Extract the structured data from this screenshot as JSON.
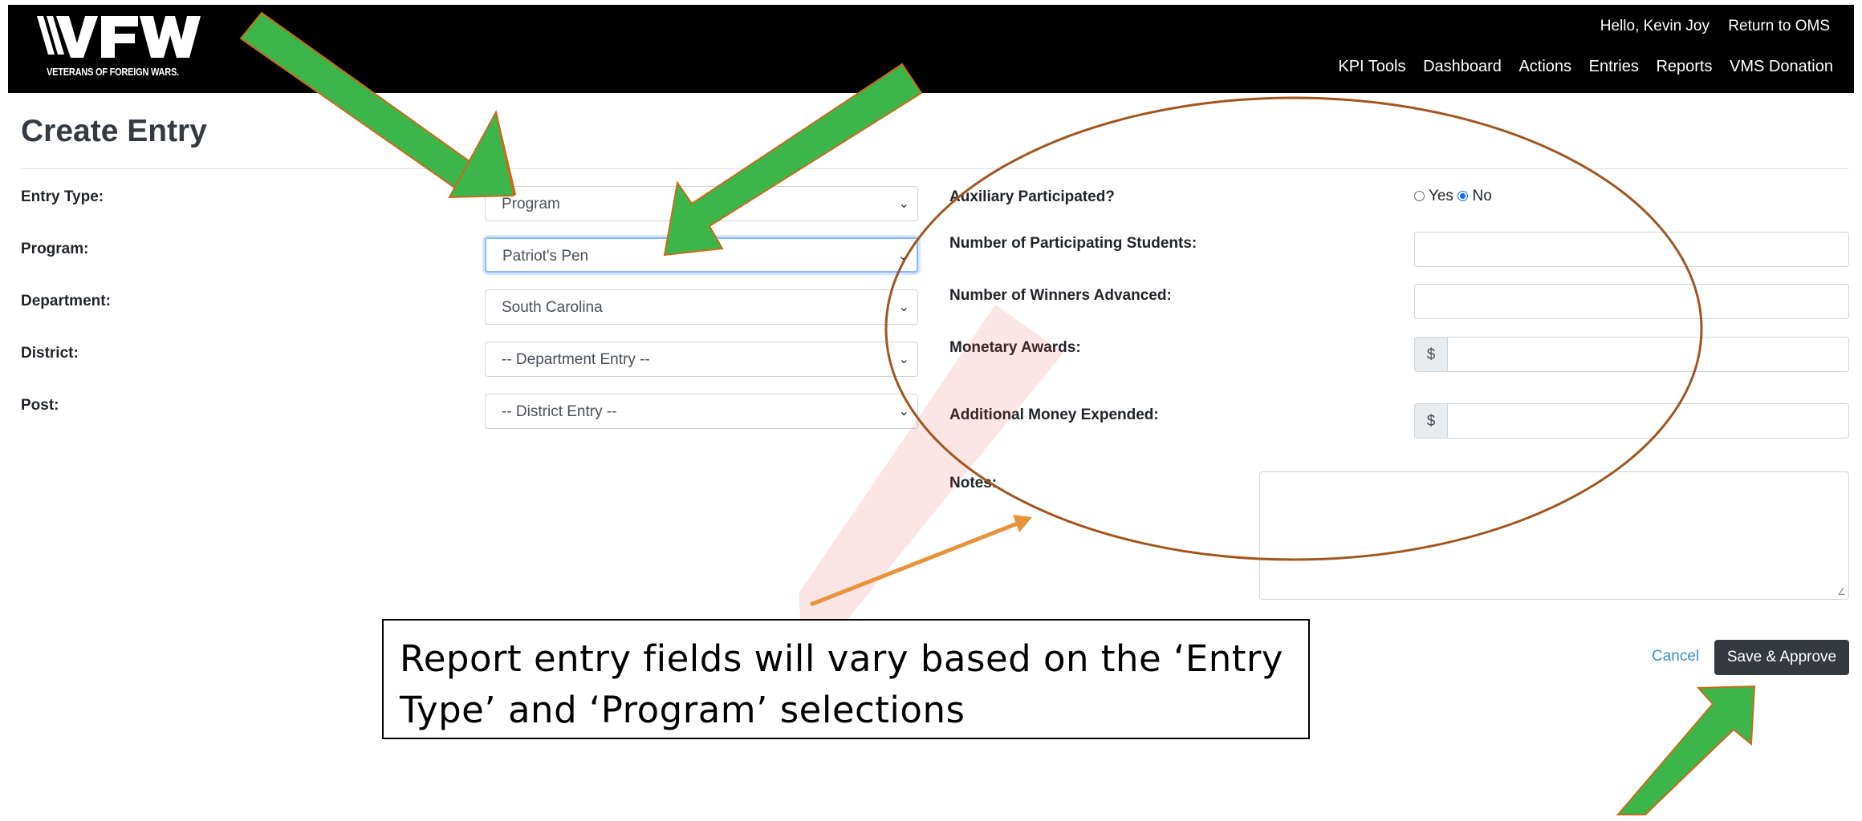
{
  "header": {
    "logo_text": "VETERANS OF FOREIGN WARS.",
    "greeting": "Hello, Kevin Joy",
    "return_link": "Return to OMS",
    "nav": [
      "KPI Tools",
      "Dashboard",
      "Actions",
      "Entries",
      "Reports",
      "VMS Donation"
    ]
  },
  "page": {
    "title": "Create Entry"
  },
  "form_left": {
    "entry_type": {
      "label": "Entry Type:",
      "value": "Program"
    },
    "program": {
      "label": "Program:",
      "value": "Patriot's Pen"
    },
    "department": {
      "label": "Department:",
      "value": "South Carolina"
    },
    "district": {
      "label": "District:",
      "value": "-- Department Entry --"
    },
    "post": {
      "label": "Post:",
      "value": "-- District Entry --"
    }
  },
  "form_right": {
    "auxiliary": {
      "label": "Auxiliary Participated?",
      "yes": "Yes",
      "no": "No",
      "selected": "No"
    },
    "students": {
      "label": "Number of Participating Students:"
    },
    "winners": {
      "label": "Number of Winners Advanced:"
    },
    "monetary": {
      "label": "Monetary Awards:",
      "prefix": "$"
    },
    "additional": {
      "label": "Additional Money Expended:",
      "prefix": "$"
    },
    "notes": {
      "label": "Notes:"
    }
  },
  "actions": {
    "cancel": "Cancel",
    "save": "Save & Approve"
  },
  "annotation": {
    "callout_line1": "Report entry fields will vary based on the ‘Entry",
    "callout_line2": "Type’ and ‘Program’ selections"
  },
  "colors": {
    "arrow_green": "#3cb64a",
    "arrow_outline": "#c96a1a",
    "ellipse": "#a0561f",
    "pointer_orange": "#e8923a",
    "primary_button": "#343a40"
  }
}
